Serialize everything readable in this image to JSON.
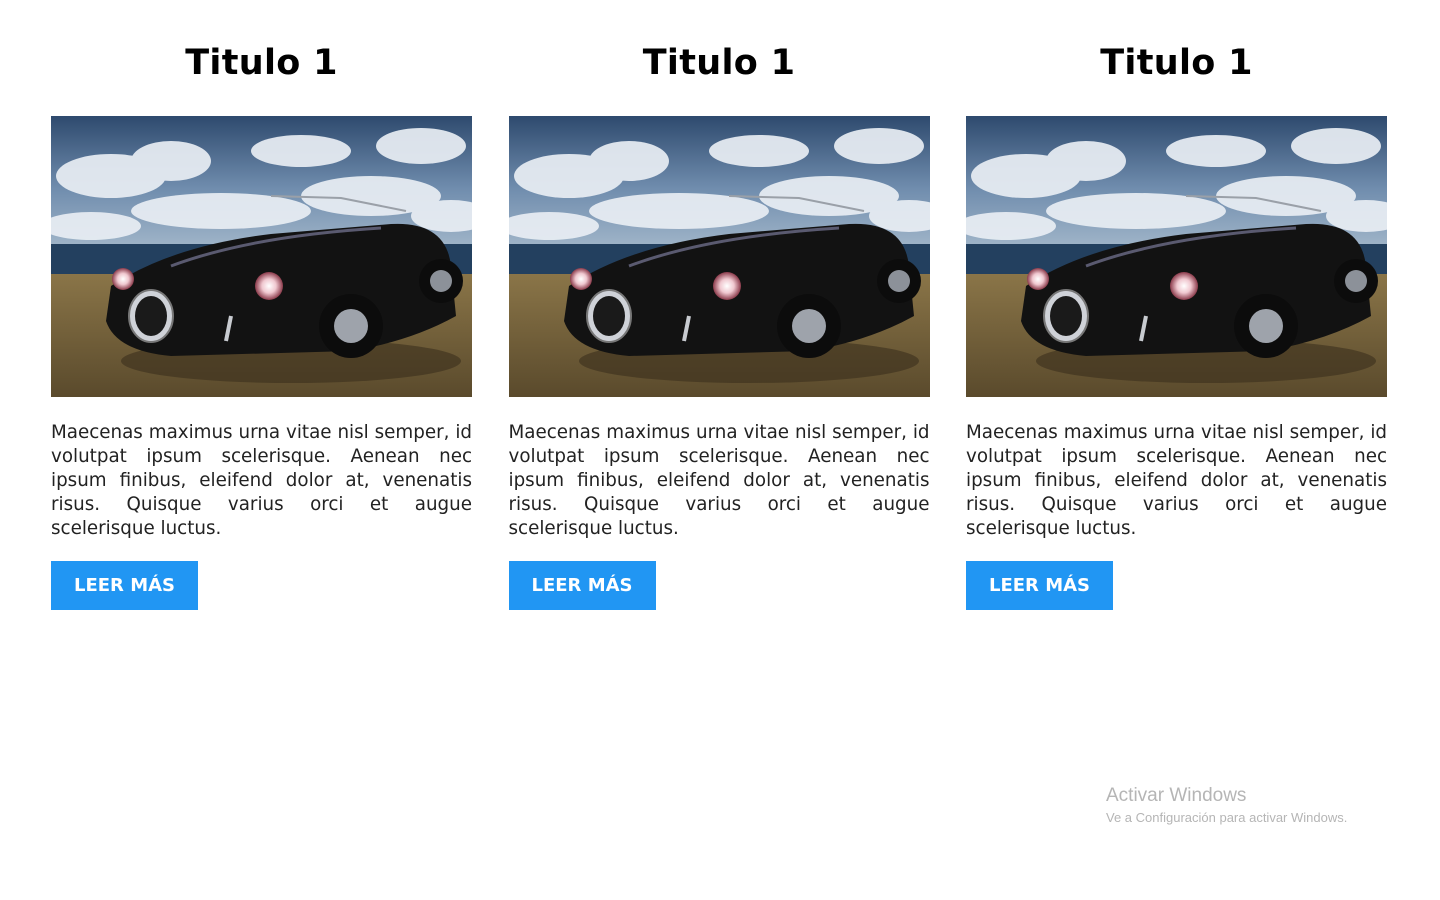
{
  "cards": [
    {
      "title": "Titulo 1",
      "text": "Maecenas maximus urna vitae nisl semper, id volutpat ipsum scelerisque. Aenean nec ipsum finibus, eleifend dolor at, venenatis risus. Quisque varius orci et augue scelerisque luctus.",
      "button_label": "LEER MÁS"
    },
    {
      "title": "Titulo 1",
      "text": "Maecenas maximus urna vitae nisl semper, id volutpat ipsum scelerisque. Aenean nec ipsum finibus, eleifend dolor at, venenatis risus. Quisque varius orci et augue scelerisque luctus.",
      "button_label": "LEER MÁS"
    },
    {
      "title": "Titulo 1",
      "text": "Maecenas maximus urna vitae nisl semper, id volutpat ipsum scelerisque. Aenean nec ipsum finibus, eleifend dolor at, venenatis risus. Quisque varius orci et augue scelerisque luctus.",
      "button_label": "LEER MÁS"
    }
  ],
  "watermark": {
    "title": "Activar Windows",
    "subtitle": "Ve a Configuración para activar Windows."
  },
  "colors": {
    "button": "#2196f3",
    "button_text": "#ffffff",
    "title": "#000000",
    "body_text": "#222222",
    "watermark": "#b5b5b5"
  }
}
